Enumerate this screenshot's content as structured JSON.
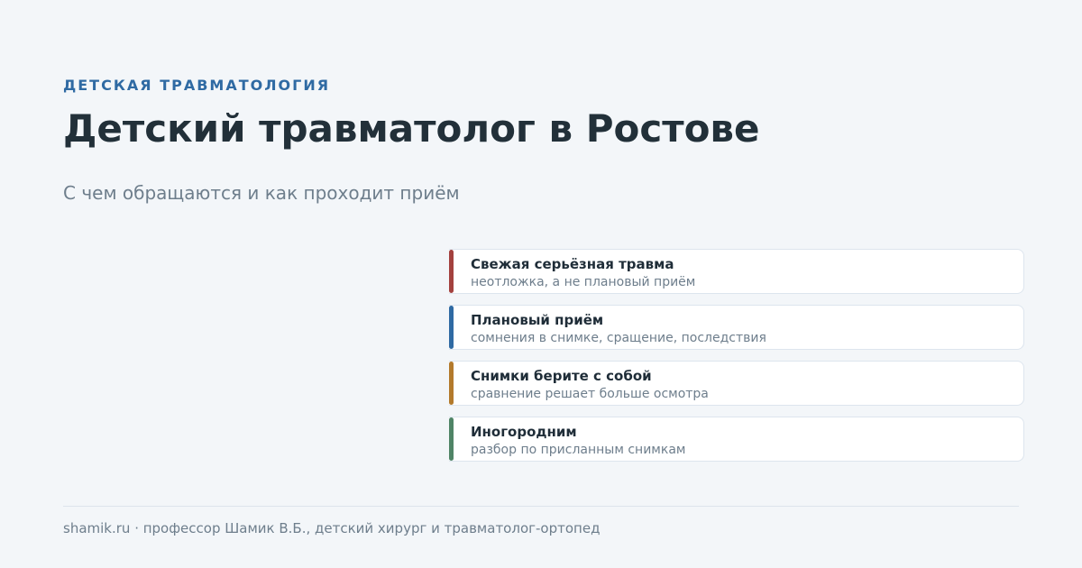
{
  "header": {
    "eyebrow": "ДЕТСКАЯ ТРАВМАТОЛОГИЯ",
    "title": "Детский травматолог в Ростове",
    "subtitle": "С чем обращаются и как проходит приём"
  },
  "cards": [
    {
      "title": "Свежая серьёзная травма",
      "subtitle": "неотложка, а не плановый приём",
      "accent": "#a3413e"
    },
    {
      "title": "Плановый приём",
      "subtitle": "сомнения в снимке, сращение, последствия",
      "accent": "#2f6aa3"
    },
    {
      "title": "Снимки берите с собой",
      "subtitle": "сравнение решает больше осмотра",
      "accent": "#b37a2c"
    },
    {
      "title": "Иногородним",
      "subtitle": "разбор по присланным снимкам",
      "accent": "#4f8466"
    }
  ],
  "footer": {
    "text": "shamik.ru · профессор Шамик В.Б., детский хирург и травматолог-ортопед"
  }
}
